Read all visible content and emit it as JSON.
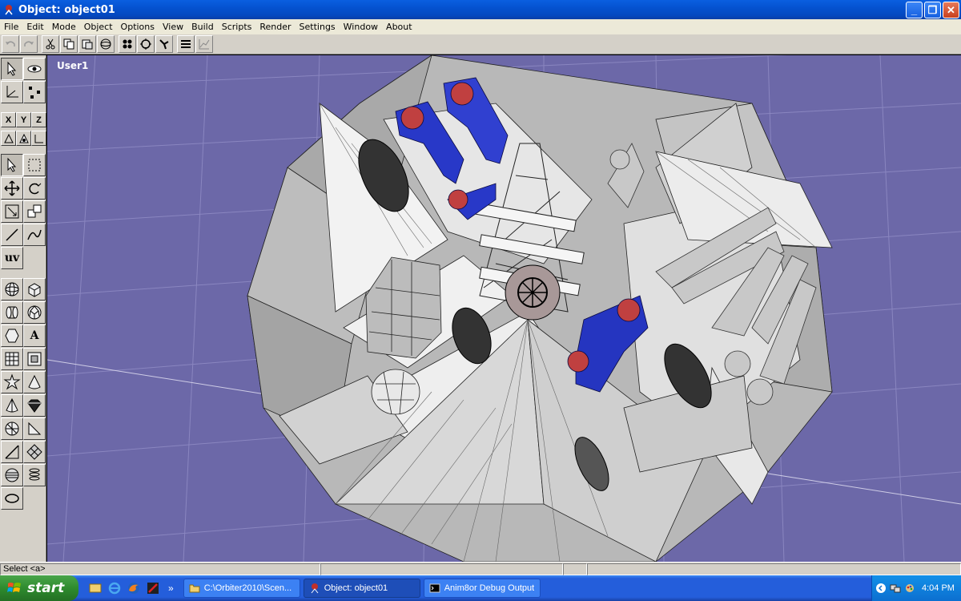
{
  "window": {
    "title": "Object: object01",
    "minimize_label": "_",
    "maximize_label": "❐",
    "close_label": "✕"
  },
  "menu": [
    "File",
    "Edit",
    "Mode",
    "Object",
    "Options",
    "View",
    "Build",
    "Scripts",
    "Render",
    "Settings",
    "Window",
    "About"
  ],
  "toolbar": {
    "icons": [
      "undo-icon",
      "redo-icon",
      "cut-icon",
      "copy-icon",
      "paste-icon",
      "sphere-view-icon",
      "grid-icon",
      "rotate-icon",
      "snap-icon",
      "list-icon",
      "graph-icon"
    ]
  },
  "palette": {
    "axis_x": "X",
    "axis_y": "Y",
    "axis_z": "Z",
    "uv_label": "uv",
    "text_tool_label": "A"
  },
  "viewport": {
    "label": "User1",
    "background": "#6c68a8"
  },
  "status": {
    "text": "Select <a>"
  },
  "taskbar": {
    "start_label": "start",
    "tasks": [
      {
        "label": "C:\\Orbiter2010\\Scen...",
        "icon": "folder-icon"
      },
      {
        "label": "Object: object01",
        "icon": "anim8or-icon",
        "active": true
      },
      {
        "label": "Anim8or Debug Output",
        "icon": "console-icon"
      }
    ],
    "quicklaunch_more": "»",
    "clock": "4:04 PM"
  }
}
